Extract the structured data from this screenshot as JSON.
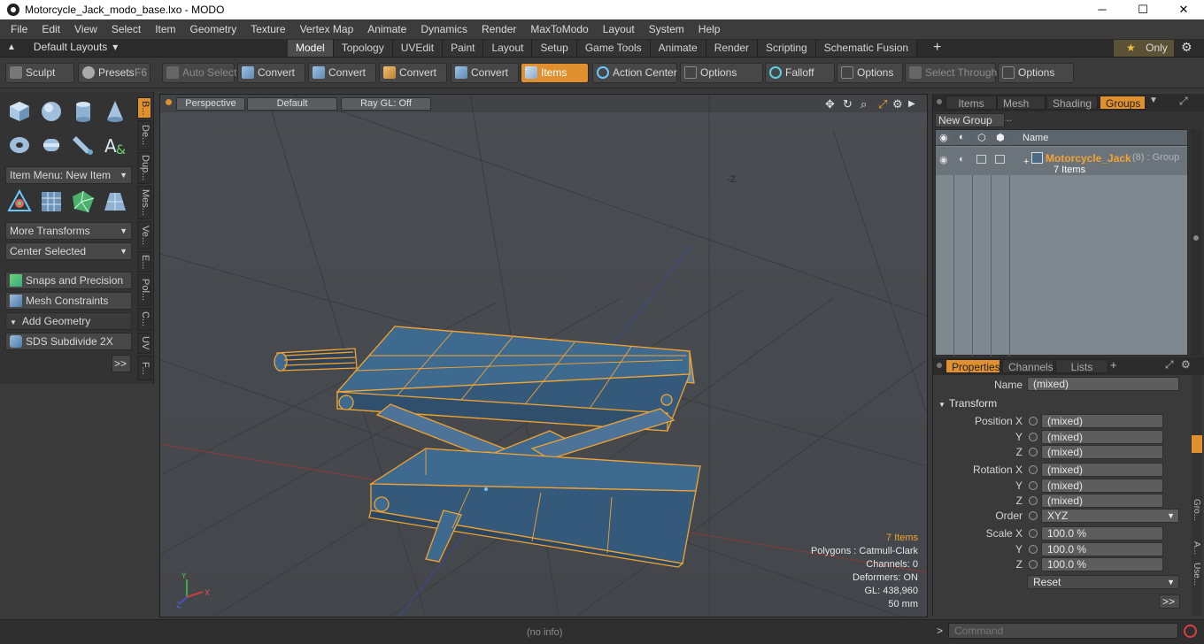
{
  "window": {
    "title": "Motorcycle_Jack_modo_base.lxo - MODO",
    "minimize": "─",
    "maximize": "☐",
    "close": "✕"
  },
  "menu": [
    "File",
    "Edit",
    "View",
    "Select",
    "Item",
    "Geometry",
    "Texture",
    "Vertex Map",
    "Animate",
    "Dynamics",
    "Render",
    "MaxToModo",
    "Layout",
    "System",
    "Help"
  ],
  "layouts": {
    "label": "Default Layouts",
    "arrow": "▾"
  },
  "layout_tabs": [
    "Model",
    "Topology",
    "UVEdit",
    "Paint",
    "Layout",
    "Setup",
    "Game Tools",
    "Animate",
    "Render",
    "Scripting",
    "Schematic Fusion"
  ],
  "layout_active": "Model",
  "plus": "+",
  "only": {
    "star": "★",
    "label": "Only"
  },
  "gear": "⚙",
  "toolbar": {
    "sculpt": "Sculpt",
    "presets": "Presets",
    "presets_key": "F6",
    "auto_select": "Auto Select",
    "convert": "Convert",
    "items": "Items",
    "action_center": "Action Center",
    "options": "Options",
    "falloff": "Falloff",
    "select_through": "Select Through"
  },
  "left": {
    "item_menu": "Item Menu: New Item",
    "more_transforms": "More Transforms",
    "center_selected": "Center Selected",
    "snaps": "Snaps and Precision",
    "mesh_constraints": "Mesh Constraints",
    "add_geometry": "Add Geometry",
    "sds": "SDS Subdivide 2X",
    "more": ">>",
    "vtabs": [
      "B...",
      "De...",
      "Dup...",
      "Mes...",
      "Ve...",
      "E...",
      "Pol...",
      "C...",
      "UV",
      "F..."
    ]
  },
  "viewport": {
    "perspective": "Perspective",
    "shading": "Default",
    "raygl": "Ray GL: Off",
    "axis_z": "-Z",
    "info": {
      "items": "7 Items",
      "polygons": "Polygons : Catmull-Clark",
      "channels": "Channels: 0",
      "deformers": "Deformers: ON",
      "gl": "GL: 438,960",
      "unit": "50 mm"
    }
  },
  "groups_panel": {
    "tabs": [
      "Items",
      "Mesh ...",
      "Shading",
      "Groups"
    ],
    "active": "Groups",
    "new_group": "New Group",
    "col_name": "Name",
    "group_name": "Motorcycle_Jack",
    "group_extra": "(8) : Group",
    "group_sub": "7 Items"
  },
  "props_panel": {
    "tabs": [
      "Properties",
      "Channels",
      "Lists"
    ],
    "active": "Properties",
    "name_label": "Name",
    "name_value": "(mixed)",
    "transform": "Transform",
    "position": "Position X",
    "rotation": "Rotation X",
    "order": "Order",
    "order_value": "XYZ",
    "scale": "Scale X",
    "y": "Y",
    "z": "Z",
    "mixed": "(mixed)",
    "scale_value": "100.0 %",
    "reset": "Reset",
    "more": ">>",
    "side_tabs": [
      "Gro...",
      "A...",
      "Use..."
    ]
  },
  "status": {
    "info": "(no info)",
    "command_placeholder": "Command",
    "prompt": ">"
  },
  "colors": {
    "accent": "#e0902f",
    "wire": "#f3a32f",
    "mesh": "#3f6a90"
  }
}
